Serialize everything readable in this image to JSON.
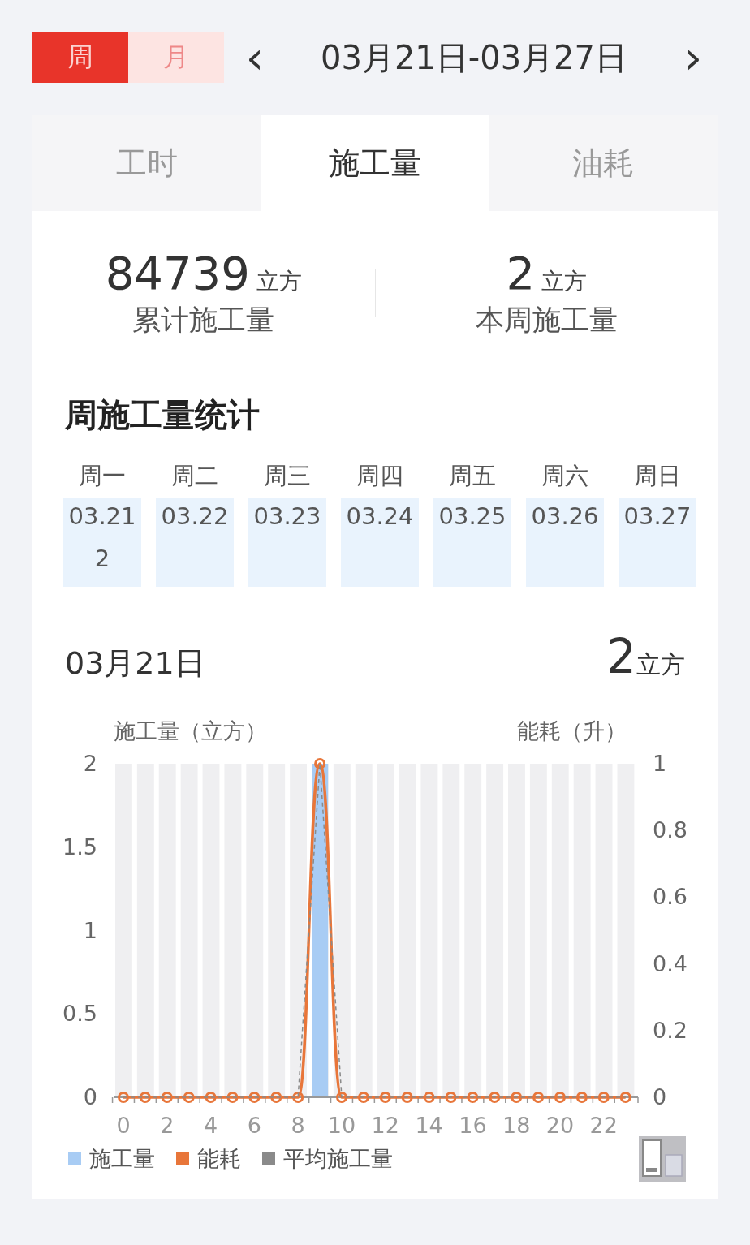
{
  "period_tabs": [
    {
      "label": "周",
      "selected": true
    },
    {
      "label": "月",
      "selected": false
    }
  ],
  "date_range": {
    "prev": "‹",
    "label": "03月21日-03月27日",
    "next": "›"
  },
  "metric_tabs": [
    {
      "label": "工时",
      "selected": false
    },
    {
      "label": "施工量",
      "selected": true
    },
    {
      "label": "油耗",
      "selected": false
    }
  ],
  "stats": [
    {
      "value": "84739",
      "unit": "立方",
      "label": "累计施工量"
    },
    {
      "value": "2",
      "unit": "立方",
      "label": "本周施工量"
    }
  ],
  "section_title": "周施工量统计",
  "days": [
    {
      "weekday": "周一",
      "date": "03.21",
      "amount": "2"
    },
    {
      "weekday": "周二",
      "date": "03.22"
    },
    {
      "weekday": "周三",
      "date": "03.23"
    },
    {
      "weekday": "周四",
      "date": "03.24"
    },
    {
      "weekday": "周五",
      "date": "03.25"
    },
    {
      "weekday": "周六",
      "date": "03.26"
    },
    {
      "weekday": "周日",
      "date": "03.27"
    }
  ],
  "detail": {
    "date": "03月21日",
    "value": "2",
    "unit": "立方"
  },
  "chart_data": {
    "type": "bar",
    "ylabel": "施工量（立方）",
    "y2label": "能耗（升）",
    "x": [
      0,
      1,
      2,
      3,
      4,
      5,
      6,
      7,
      8,
      9,
      10,
      11,
      12,
      13,
      14,
      15,
      16,
      17,
      18,
      19,
      20,
      21,
      22,
      23
    ],
    "xlim": [
      -0.5,
      23.5
    ],
    "xticks": [
      0,
      2,
      4,
      6,
      8,
      10,
      12,
      14,
      16,
      18,
      20,
      22
    ],
    "stacked": false,
    "ylim": [
      0,
      2
    ],
    "yticks": [
      0,
      0.5,
      1,
      1.5,
      2
    ],
    "y2lim": [
      0,
      1
    ],
    "y2ticks": [
      0,
      0.2,
      0.4,
      0.6,
      0.8,
      1
    ],
    "series": [
      {
        "name": "施工量",
        "type": "bar",
        "color": "#a8ccf4",
        "values": [
          0,
          0,
          0,
          0,
          0,
          0,
          0,
          0,
          0,
          2,
          0,
          0,
          0,
          0,
          0,
          0,
          0,
          0,
          0,
          0,
          0,
          0,
          0,
          0
        ]
      },
      {
        "name": "能耗",
        "type": "line",
        "axis": "y2",
        "marker": "circle",
        "color": "#e8763a",
        "values": [
          0,
          0,
          0,
          0,
          0,
          0,
          0,
          0,
          0,
          1,
          0,
          0,
          0,
          0,
          0,
          0,
          0,
          0,
          0,
          0,
          0,
          0,
          0,
          0
        ]
      },
      {
        "name": "平均施工量",
        "type": "line",
        "line_style": "dashed",
        "color": "#8a8a8a",
        "values": [
          0,
          0,
          0,
          0,
          0,
          0,
          0,
          0,
          0,
          2,
          0,
          0,
          0,
          0,
          0,
          0,
          0,
          0,
          0,
          0,
          0,
          0,
          0,
          0
        ]
      }
    ]
  }
}
